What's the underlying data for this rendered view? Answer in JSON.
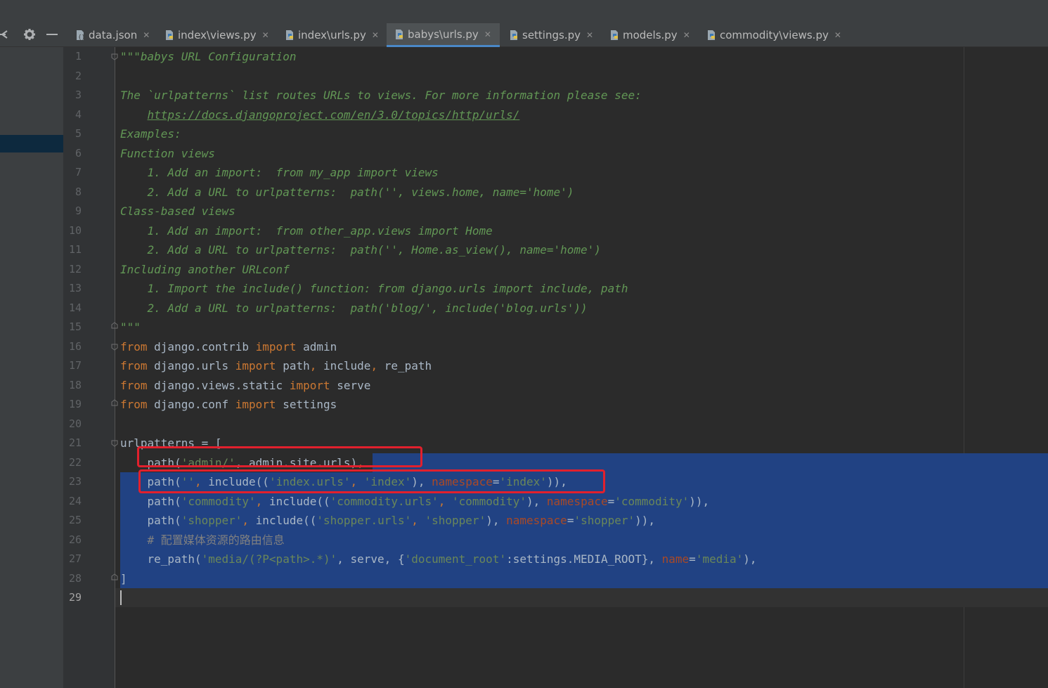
{
  "tabs": [
    {
      "label": "data.json",
      "active": false,
      "icon": "json-file-icon"
    },
    {
      "label": "index\\views.py",
      "active": false,
      "icon": "python-file-icon"
    },
    {
      "label": "index\\urls.py",
      "active": false,
      "icon": "python-file-icon"
    },
    {
      "label": "babys\\urls.py",
      "active": true,
      "icon": "python-file-icon"
    },
    {
      "label": "settings.py",
      "active": false,
      "icon": "python-file-icon"
    },
    {
      "label": "models.py",
      "active": false,
      "icon": "python-file-icon"
    },
    {
      "label": "commodity\\views.py",
      "active": false,
      "icon": "python-file-icon"
    }
  ],
  "toolbar": {
    "gear_icon": "gear-icon",
    "minimize_icon": "minimize-icon",
    "collapse_icon": "collapse-icon"
  },
  "editor": {
    "current_line": 29,
    "line_numbers": [
      "1",
      "2",
      "3",
      "4",
      "5",
      "6",
      "7",
      "8",
      "9",
      "10",
      "11",
      "12",
      "13",
      "14",
      "15",
      "16",
      "17",
      "18",
      "19",
      "20",
      "21",
      "22",
      "23",
      "24",
      "25",
      "26",
      "27",
      "28",
      "29"
    ],
    "lines": {
      "l1": "\"\"\"babys URL Configuration",
      "l3": "The `urlpatterns` list routes URLs to views. For more information please see:",
      "l4_indent": "    ",
      "l4_link": "https://docs.djangoproject.com/en/3.0/topics/http/urls/",
      "l5": "Examples:",
      "l6": "Function views",
      "l7": "    1. Add an import:  from my_app import views",
      "l8": "    2. Add a URL to urlpatterns:  path('', views.home, name='home')",
      "l9": "Class-based views",
      "l10": "    1. Add an import:  from other_app.views import Home",
      "l11": "    2. Add a URL to urlpatterns:  path('', Home.as_view(), name='home')",
      "l12": "Including another URLconf",
      "l13": "    1. Import the include() function: from django.urls import include, path",
      "l14": "    2. Add a URL to urlpatterns:  path('blog/', include('blog.urls'))",
      "l15": "\"\"\"",
      "t_from": "from",
      "t_import": "import",
      "l16_mod": " django.contrib ",
      "l16_name": " admin",
      "l17_mod": " django.urls ",
      "l17_a": " path",
      "l17_b": " include",
      "l17_c": " re_path",
      "comma": ",",
      "l18_mod": " django.views.static ",
      "l18_name": " serve",
      "l19_mod": " django.conf ",
      "l19_name": " settings",
      "l21": "urlpatterns = [",
      "l22_a": "    path(",
      "l22_s": "'admin/'",
      "l22_b": ", admin.site.urls)",
      "l22_c": ",",
      "l23_a": "    path(",
      "l23_s1": "''",
      "l23_c1": ", ",
      "l23_b": "include((",
      "l23_s2": "'index.urls'",
      "l23_c2": ", ",
      "l23_s3": "'index'",
      "l23_c3": "), ",
      "l23_n": "namespace",
      "l23_eq": "=",
      "l23_s4": "'index'",
      "l23_end": ")),",
      "l24_a": "    path(",
      "l24_s1": "'commodity'",
      "l24_c1": ", ",
      "l24_b": "include((",
      "l24_s2": "'commodity.urls'",
      "l24_c2": ", ",
      "l24_s3": "'commodity'",
      "l24_c3": "), ",
      "l24_n": "namespace",
      "l24_eq": "=",
      "l24_s4": "'commodity'",
      "l24_end": ")),",
      "l25_a": "    path(",
      "l25_s1": "'shopper'",
      "l25_c1": ", ",
      "l25_b": "include((",
      "l25_s2": "'shopper.urls'",
      "l25_c2": ", ",
      "l25_s3": "'shopper'",
      "l25_c3": "), ",
      "l25_n": "namespace",
      "l25_eq": "=",
      "l25_s4": "'shopper'",
      "l25_end": ")),",
      "l26": "    # 配置媒体资源的路由信息",
      "l27_a": "    re_path(",
      "l27_s1": "'media/(?P<path>.*)'",
      "l27_c1": ", serve, {",
      "l27_s2": "'document_root'",
      "l27_c2": ":settings.MEDIA_ROOT}, ",
      "l27_n": "name",
      "l27_eq": "=",
      "l27_s3": "'media'",
      "l27_end": "),",
      "l28": "]"
    }
  },
  "colors": {
    "background": "#2b2b2b",
    "selection": "#214283",
    "annotation_box": "#e2202d",
    "keyword": "#cc7832",
    "string": "#6a8759",
    "docstring": "#629755",
    "named_arg": "#aa4926"
  }
}
